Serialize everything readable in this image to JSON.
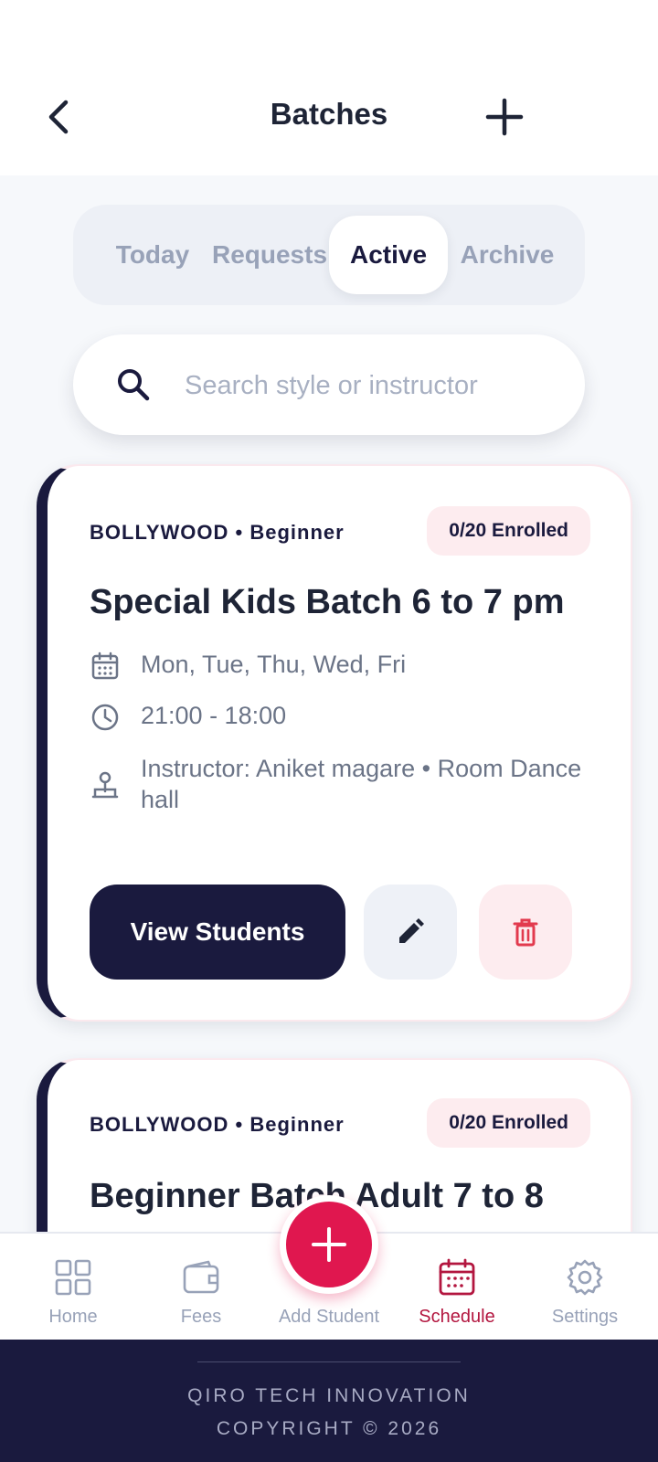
{
  "header": {
    "title": "Batches"
  },
  "tabs": [
    {
      "label": "Today"
    },
    {
      "label": "Requests"
    },
    {
      "label": "Active"
    },
    {
      "label": "Archive"
    }
  ],
  "active_tab": "Active",
  "search": {
    "placeholder": "Search style or instructor",
    "value": ""
  },
  "batches": [
    {
      "style": "BOLLYWOOD • Beginner",
      "enrolled": "0/20 Enrolled",
      "title": "Special Kids Batch 6 to 7 pm",
      "days": "Mon, Tue, Thu, Wed, Fri",
      "time": "21:00 - 18:00",
      "instructor": "Instructor: Aniket magare • Room Dance hall",
      "view_label": "View Students"
    },
    {
      "style": "BOLLYWOOD • Beginner",
      "enrolled": "0/20 Enrolled",
      "title": "Beginner Batch Adult 7 to 8"
    }
  ],
  "nav": {
    "items": [
      {
        "label": "Home",
        "icon": "grid-icon"
      },
      {
        "label": "Fees",
        "icon": "wallet-icon"
      },
      {
        "label": "Add Student",
        "icon": "plus-icon"
      },
      {
        "label": "Schedule",
        "icon": "calendar-icon"
      },
      {
        "label": "Settings",
        "icon": "gear-icon"
      }
    ],
    "active": "Schedule"
  },
  "footer": {
    "company": "QIRO TECH INNOVATION",
    "copyright": "COPYRIGHT © 2026"
  },
  "colors": {
    "primary": "#1a1a3e",
    "accent": "#e0174f",
    "active_nav": "#b3163f",
    "badge_bg": "#fdecef",
    "delete": "#e23a4e"
  }
}
